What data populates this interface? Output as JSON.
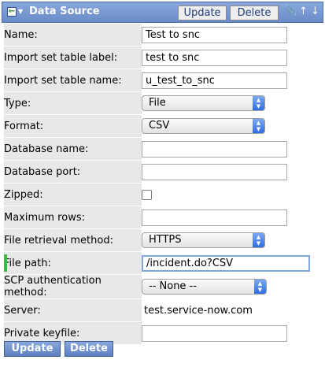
{
  "header": {
    "title": "Data Source",
    "update_label": "Update",
    "delete_label": "Delete"
  },
  "fields": [
    {
      "label": "Name:",
      "value": "Test to snc"
    },
    {
      "label": "Import set table label:",
      "value": "test to snc"
    },
    {
      "label": "Import set table name:",
      "value": "u_test_to_snc"
    },
    {
      "label": "Type:",
      "value": "File"
    },
    {
      "label": "Format:",
      "value": "CSV"
    },
    {
      "label": "Database name:",
      "value": ""
    },
    {
      "label": "Database port:",
      "value": ""
    },
    {
      "label": "Zipped:",
      "checked": false
    },
    {
      "label": "Maximum rows:",
      "value": ""
    },
    {
      "label": "File retrieval method:",
      "value": "HTTPS"
    },
    {
      "label": "File path:",
      "value": "/incident.do?CSV"
    },
    {
      "label": "SCP authentication method:",
      "value": "-- None --"
    },
    {
      "label": "Server:",
      "value": "test.service-now.com"
    },
    {
      "label": "Private keyfile:",
      "value": ""
    }
  ],
  "footer": {
    "update_label": "Update",
    "delete_label": "Delete"
  },
  "colors": {
    "header": "#7a9ad6",
    "label_bg": "#e8e8e8",
    "mandatory": "#3cba3c"
  }
}
